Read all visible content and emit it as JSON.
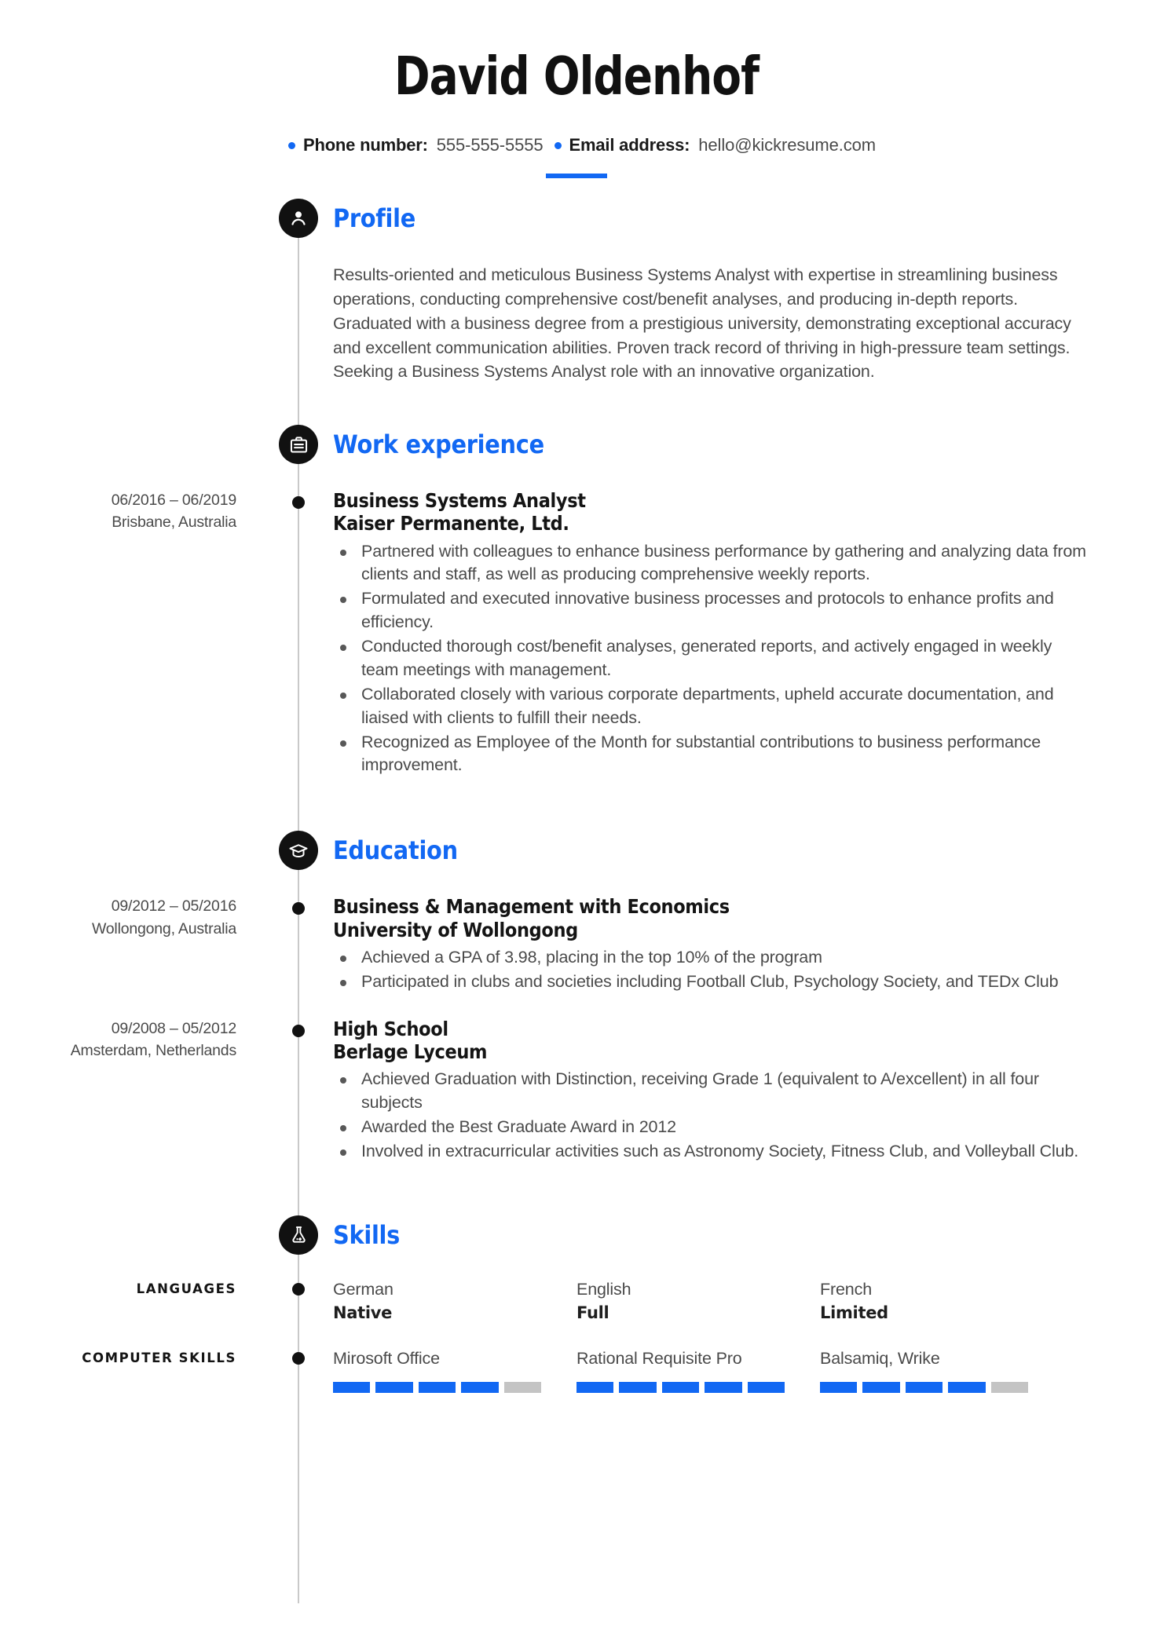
{
  "theme": {
    "accent": "#1268f3",
    "ink": "#141414",
    "body_text": "#4a4a4a",
    "timeline": "#c9c9c9",
    "bar_off": "#c4c4c4"
  },
  "header": {
    "name": "David Oldenhof",
    "contacts": [
      {
        "label": "Phone number:",
        "value": "555-555-5555",
        "icon": "bullet-dot-icon"
      },
      {
        "label": "Email address:",
        "value": "hello@kickresume.com",
        "icon": "bullet-dot-icon"
      }
    ]
  },
  "sections": {
    "profile": {
      "title": "Profile",
      "icon": "person-icon",
      "text": "Results-oriented and meticulous Business Systems Analyst with expertise in streamlining business operations, conducting comprehensive cost/benefit analyses, and producing in-depth reports. Graduated with a business degree from a prestigious university, demonstrating exceptional accuracy and excellent communication abilities. Proven track record of thriving in high-pressure team settings. Seeking a Business Systems Analyst role with an innovative organization."
    },
    "work": {
      "title": "Work experience",
      "icon": "briefcase-icon",
      "entries": [
        {
          "dates": "06/2016 – 06/2019",
          "location": "Brisbane, Australia",
          "title": "Business Systems Analyst",
          "organization": "Kaiser Permanente, Ltd.",
          "bullets": [
            "Partnered with colleagues to enhance business performance by gathering and analyzing data from clients and staff, as well as producing comprehensive weekly reports.",
            "Formulated and executed innovative business processes and protocols to enhance profits and efficiency.",
            "Conducted thorough cost/benefit analyses, generated reports, and actively engaged in weekly team meetings with management.",
            "Collaborated closely with various corporate departments, upheld accurate documentation, and liaised with clients to fulfill their needs.",
            "Recognized as Employee of the Month for substantial contributions to business performance improvement."
          ]
        }
      ]
    },
    "education": {
      "title": "Education",
      "icon": "graduation-cap-icon",
      "entries": [
        {
          "dates": "09/2012 – 05/2016",
          "location": "Wollongong, Australia",
          "title": "Business & Management with Economics",
          "organization": "University of Wollongong",
          "bullets": [
            "Achieved a GPA of 3.98, placing in the top 10% of the program",
            "Participated in clubs and societies including Football Club, Psychology Society, and TEDx Club"
          ]
        },
        {
          "dates": "09/2008 – 05/2012",
          "location": "Amsterdam, Netherlands",
          "title": "High School",
          "organization": "Berlage Lyceum",
          "bullets": [
            "Achieved Graduation with Distinction, receiving Grade 1 (equivalent to A/excellent) in all four subjects",
            "Awarded the Best Graduate Award in 2012",
            "Involved in extracurricular activities such as Astronomy Society, Fitness Club, and Volleyball Club."
          ]
        }
      ]
    },
    "skills": {
      "title": "Skills",
      "icon": "flask-icon",
      "languages": {
        "label": "LANGUAGES",
        "items": [
          {
            "name": "German",
            "level": "Native"
          },
          {
            "name": "English",
            "level": "Full"
          },
          {
            "name": "French",
            "level": "Limited"
          }
        ]
      },
      "computer": {
        "label": "COMPUTER SKILLS",
        "items": [
          {
            "name": "Mirosoft Office",
            "filled": 4,
            "total": 5
          },
          {
            "name": "Rational Requisite Pro",
            "filled": 5,
            "total": 5
          },
          {
            "name": "Balsamiq, Wrike",
            "filled": 4,
            "total": 5
          }
        ]
      }
    }
  }
}
